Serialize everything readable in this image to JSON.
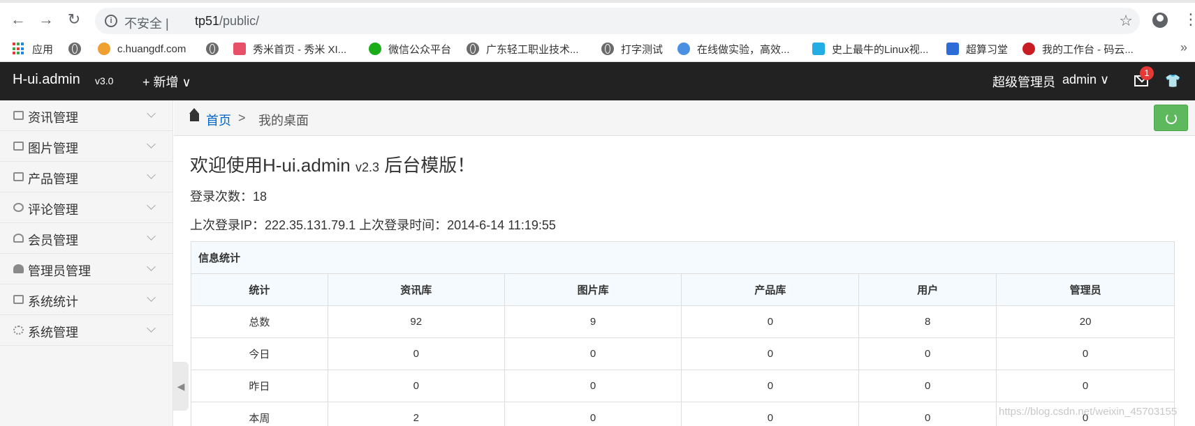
{
  "browser": {
    "insecure_label": "不安全 |",
    "url_host": "tp51",
    "url_path": "/public/",
    "bookmarks": [
      {
        "label": "应用",
        "icon": "apps-grid-icon"
      },
      {
        "label": "",
        "icon": "globe-icon"
      },
      {
        "label": "c.huangdf.com",
        "icon": "site-icon"
      },
      {
        "label": "",
        "icon": "globe-icon"
      },
      {
        "label": "秀米首页 - 秀米 XI...",
        "icon": "xiumi-icon"
      },
      {
        "label": "微信公众平台",
        "icon": "wechat-icon"
      },
      {
        "label": "广东轻工职业技术...",
        "icon": "globe-icon"
      },
      {
        "label": "打字测试",
        "icon": "globe-icon"
      },
      {
        "label": "在线做实验，高效...",
        "icon": "site-icon"
      },
      {
        "label": "史上最牛的Linux视...",
        "icon": "bilibili-icon"
      },
      {
        "label": "超算习堂",
        "icon": "code-icon"
      },
      {
        "label": "我的工作台 - 码云...",
        "icon": "gitee-icon"
      }
    ]
  },
  "header": {
    "brand": "H-ui.admin",
    "version": "v3.0",
    "add_menu": "+ 新增 ∨",
    "user_role": "超级管理员",
    "user_name": "admin ∨",
    "mail_badge": "1"
  },
  "sidebar": {
    "items": [
      {
        "label": "资讯管理",
        "icon": "news-icon"
      },
      {
        "label": "图片管理",
        "icon": "picture-icon"
      },
      {
        "label": "产品管理",
        "icon": "bag-icon"
      },
      {
        "label": "评论管理",
        "icon": "comment-icon"
      },
      {
        "label": "会员管理",
        "icon": "user-icon"
      },
      {
        "label": "管理员管理",
        "icon": "admin-icon"
      },
      {
        "label": "系统统计",
        "icon": "stats-icon"
      },
      {
        "label": "系统管理",
        "icon": "gear-icon"
      }
    ]
  },
  "breadcrumb": {
    "home": "首页",
    "separator": ">",
    "current": "我的桌面"
  },
  "main": {
    "welcome_prefix": "欢迎使用H-ui.admin",
    "welcome_version": "v2.3",
    "welcome_suffix": "后台模版！",
    "login_count": "登录次数：18",
    "last_login": "上次登录IP：222.35.131.79.1 上次登录时间：2014-6-14 11:19:55"
  },
  "stats": {
    "caption": "信息统计",
    "headers": [
      "统计",
      "资讯库",
      "图片库",
      "产品库",
      "用户",
      "管理员"
    ],
    "rows": [
      [
        "总数",
        "92",
        "9",
        "0",
        "8",
        "20"
      ],
      [
        "今日",
        "0",
        "0",
        "0",
        "0",
        "0"
      ],
      [
        "昨日",
        "0",
        "0",
        "0",
        "0",
        "0"
      ],
      [
        "本周",
        "2",
        "0",
        "0",
        "0",
        "0"
      ]
    ]
  },
  "watermark": "https://blog.csdn.net/weixin_45703155"
}
